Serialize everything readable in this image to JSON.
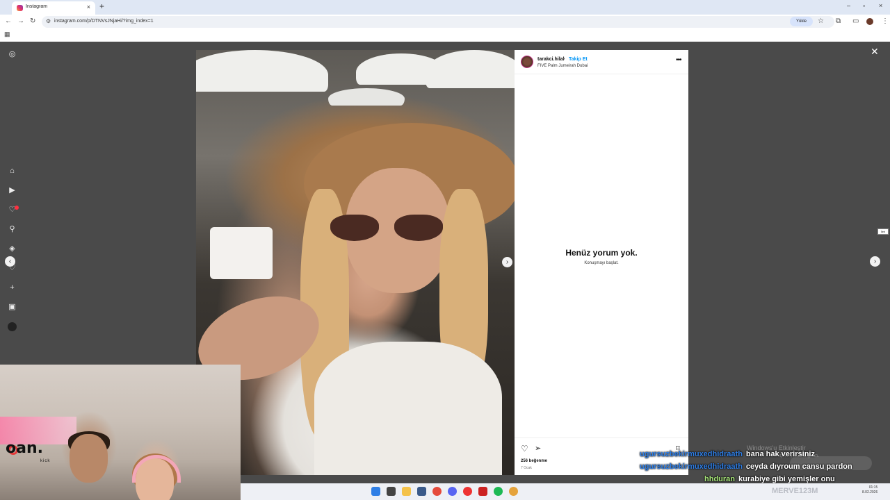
{
  "browser": {
    "tab_title": "Instagram",
    "tab_close": "×",
    "new_tab": "+",
    "url": "instagram.com/p/DTNVsJNjaHi/?img_index=1",
    "install_label": "Yükle",
    "window_controls": [
      "–",
      "▫",
      "×"
    ]
  },
  "post": {
    "username": "tarakci.hilal",
    "separator": "•",
    "follow_label": "Takip Et",
    "location": "FIVE Palm Jumeirah Dubai",
    "more": "•••",
    "no_comments_title": "Henüz yorum yok.",
    "no_comments_sub": "Konuşmayı başlat.",
    "likes": "256 beğenme",
    "date": "7 Ocak",
    "tooltip": "İleri"
  },
  "overlay": {
    "logo": "oan.",
    "logo_sub": "kick",
    "chat": [
      {
        "user": "ugursuzbekirmuxedhidraath",
        "message": "bana hak verirsiniz",
        "user_color": "#2f7fe6"
      },
      {
        "user": "ugursuzbekirmuxedhidraath",
        "message": "ceyda dıyroum cansu pardon",
        "user_color": "#2f7fe6"
      },
      {
        "user": "hhduran",
        "message": "kurabiye gibi yemişler onu",
        "user_color": "#a8e67a"
      }
    ],
    "windows_watermark": "Windows'u Etkinleştir",
    "windows_watermark_sub": "için Ayarlar'a gidin.",
    "stream_user": "MERVE123M"
  },
  "taskbar": {
    "clock": [
      "01:15",
      "8.02.2026"
    ]
  },
  "colors": {
    "follow": "#0095f6",
    "notification": "#ff3040",
    "chat_user": "#2f7fe6"
  },
  "icons": {
    "sidebar": [
      "instagram-icon",
      "home-icon",
      "reels-icon",
      "heart-icon",
      "search-icon",
      "explore-icon",
      "notifications-icon",
      "create-icon",
      "dashboard-icon",
      "profile-icon"
    ]
  }
}
